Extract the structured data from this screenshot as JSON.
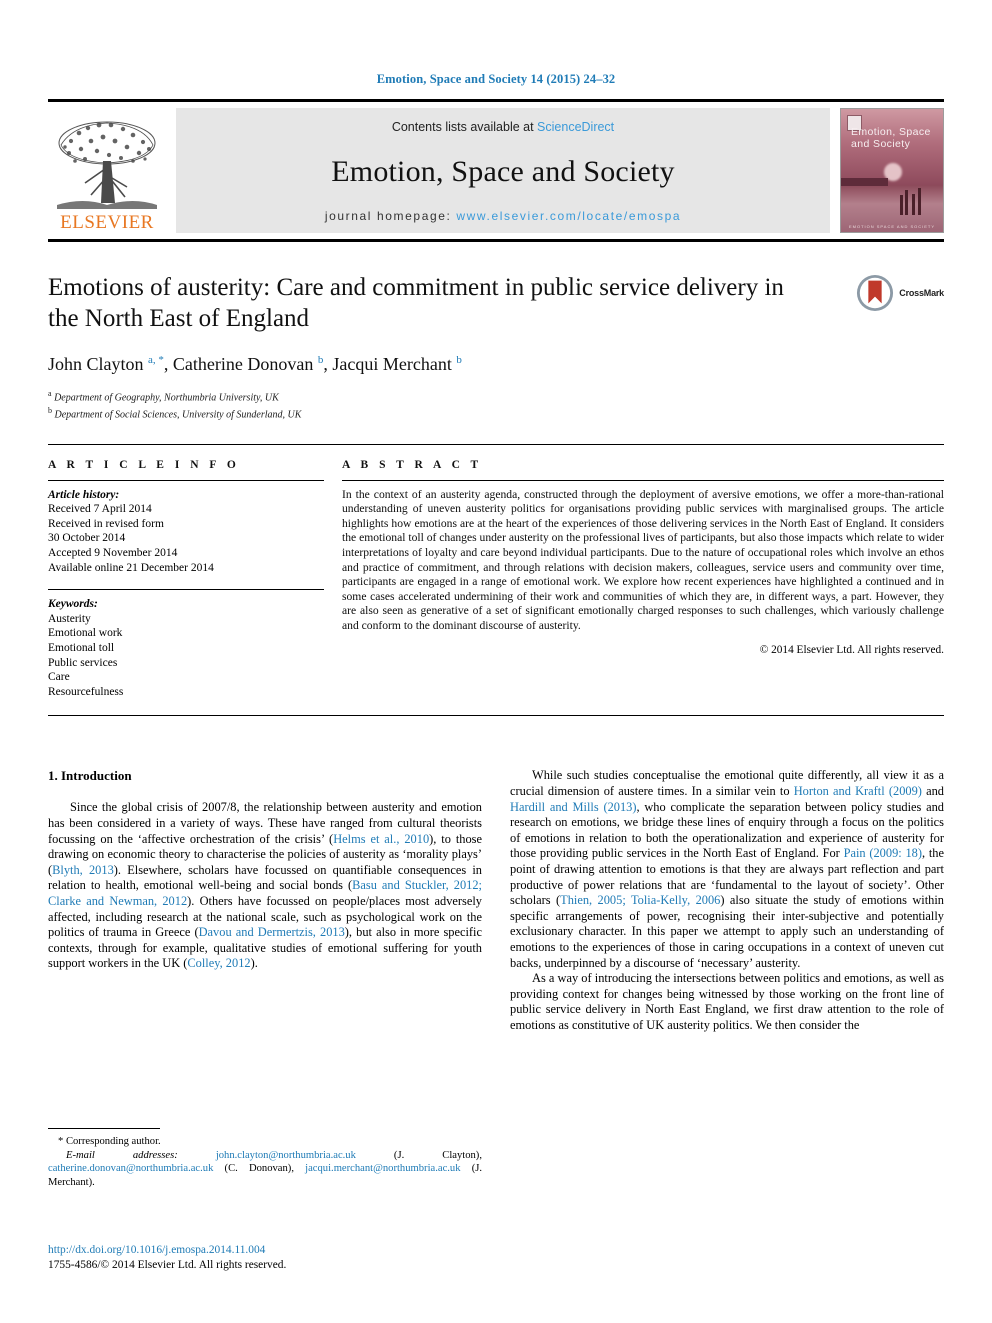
{
  "running_head": "Emotion, Space and Society 14 (2015) 24–32",
  "masthead": {
    "publisher_name": "ELSEVIER",
    "contents_prefix": "Contents lists available at ",
    "contents_link": "ScienceDirect",
    "journal_title": "Emotion, Space and Society",
    "homepage_label": "journal homepage: ",
    "homepage_url": "www.elsevier.com/locate/emospa",
    "cover_title": "Emotion, Space and Society",
    "cover_footer": "EMOTION SPACE AND SOCIETY"
  },
  "article": {
    "title": "Emotions of austerity: Care and commitment in public service delivery in the North East of England",
    "crossmark_label": "CrossMark",
    "authors_html": "John Clayton <sup>a, *</sup>, Catherine Donovan <sup>b</sup>, Jacqui Merchant <sup>b</sup>",
    "affiliations": [
      {
        "marker": "a",
        "text": "Department of Geography, Northumbria University, UK"
      },
      {
        "marker": "b",
        "text": "Department of Social Sciences, University of Sunderland, UK"
      }
    ]
  },
  "info": {
    "heading": "A R T I C L E   I N F O",
    "history_label": "Article history:",
    "history": [
      "Received 7 April 2014",
      "Received in revised form",
      "30 October 2014",
      "Accepted 9 November 2014",
      "Available online 21 December 2014"
    ],
    "keywords_label": "Keywords:",
    "keywords": [
      "Austerity",
      "Emotional work",
      "Emotional toll",
      "Public services",
      "Care",
      "Resourcefulness"
    ]
  },
  "abstract": {
    "heading": "A B S T R A C T",
    "text": "In the context of an austerity agenda, constructed through the deployment of aversive emotions, we offer a more-than-rational understanding of uneven austerity politics for organisations providing public services with marginalised groups. The article highlights how emotions are at the heart of the experiences of those delivering services in the North East of England. It considers the emotional toll of changes under austerity on the professional lives of participants, but also those impacts which relate to wider interpretations of loyalty and care beyond individual participants. Due to the nature of occupational roles which involve an ethos and practice of commitment, and through relations with decision makers, colleagues, service users and community over time, participants are engaged in a range of emotional work. We explore how recent experiences have highlighted a continued and in some cases accelerated undermining of their work and communities of which they are, in different ways, a part. However, they are also seen as generative of a set of significant emotionally charged responses to such challenges, which variously challenge and conform to the dominant discourse of austerity.",
    "copyright": "© 2014 Elsevier Ltd. All rights reserved."
  },
  "body": {
    "section_heading": "1. Introduction",
    "left_paragraphs": [
      {
        "runs": [
          {
            "t": "Since the global crisis of 2007/8, the relationship between austerity and emotion has been considered in a variety of ways. These have ranged from cultural theorists focussing on the ‘affective orchestration of the crisis’ ("
          },
          {
            "t": "Helms et al., 2010",
            "link": true
          },
          {
            "t": "), to those drawing on economic theory to characterise the policies of austerity as ‘morality plays’ ("
          },
          {
            "t": "Blyth, 2013",
            "link": true
          },
          {
            "t": "). Elsewhere, scholars have focussed on quantifiable consequences in relation to health, emotional well-being and social bonds ("
          },
          {
            "t": "Basu and Stuckler, 2012; Clarke and Newman, 2012",
            "link": true
          },
          {
            "t": "). Others have focussed on people/places most adversely affected, including research at the national scale, such as psychological work on the politics of trauma in Greece ("
          },
          {
            "t": "Davou and Dermertzis, 2013",
            "link": true
          },
          {
            "t": "), but also in more specific contexts, through for example, qualitative studies of emotional suffering for youth support workers in the UK ("
          },
          {
            "t": "Colley, 2012",
            "link": true
          },
          {
            "t": ")."
          }
        ]
      }
    ],
    "right_paragraphs": [
      {
        "runs": [
          {
            "t": "While such studies conceptualise the emotional quite differently, all view it as a crucial dimension of austere times. In a similar vein to "
          },
          {
            "t": "Horton and Kraftl (2009)",
            "link": true
          },
          {
            "t": " and "
          },
          {
            "t": "Hardill and Mills (2013)",
            "link": true
          },
          {
            "t": ", who complicate the separation between policy studies and research on emotions, we bridge these lines of enquiry through a focus on the politics of emotions in relation to both the operationalization and experience of austerity for those providing public services in the North East of England. For "
          },
          {
            "t": "Pain (2009: 18)",
            "link": true
          },
          {
            "t": ", the point of drawing attention to emotions is that they are always part reflection and part productive of power relations that are ‘fundamental to the layout of society’. Other scholars ("
          },
          {
            "t": "Thien, 2005; Tolia-Kelly, 2006",
            "link": true
          },
          {
            "t": ") also situate the study of emotions within specific arrangements of power, recognising their inter-subjective and potentially exclusionary character. In this paper we attempt to apply such an understanding of emotions to the experiences of those in caring occupations in a context of uneven cut backs, underpinned by a discourse of ‘necessary’ austerity."
          }
        ]
      },
      {
        "runs": [
          {
            "t": "As a way of introducing the intersections between politics and emotions, as well as providing context for changes being witnessed by those working on the front line of public service delivery in North East England, we first draw attention to the role of emotions as constitutive of UK austerity politics. We then consider the"
          }
        ]
      }
    ]
  },
  "footnotes": {
    "corresponding": "* Corresponding author.",
    "email_label": "E-mail addresses:",
    "emails": [
      {
        "address": "john.clayton@northumbria.ac.uk",
        "name": "(J. Clayton)"
      },
      {
        "address": "catherine.donovan@northumbria.ac.uk",
        "name": "(C. Donovan)"
      },
      {
        "address": "jacqui.merchant@northumbria.ac.uk",
        "name": "(J. Merchant)"
      }
    ]
  },
  "doi_block": {
    "doi_url": "http://dx.doi.org/10.1016/j.emospa.2014.11.004",
    "issn_line": "1755-4586/© 2014 Elsevier Ltd. All rights reserved."
  },
  "colors": {
    "link_blue": "#1f7bb6",
    "science_direct_blue": "#3b9ad9",
    "elsevier_orange": "#e87722",
    "masthead_grey": "#e6e6e6"
  }
}
